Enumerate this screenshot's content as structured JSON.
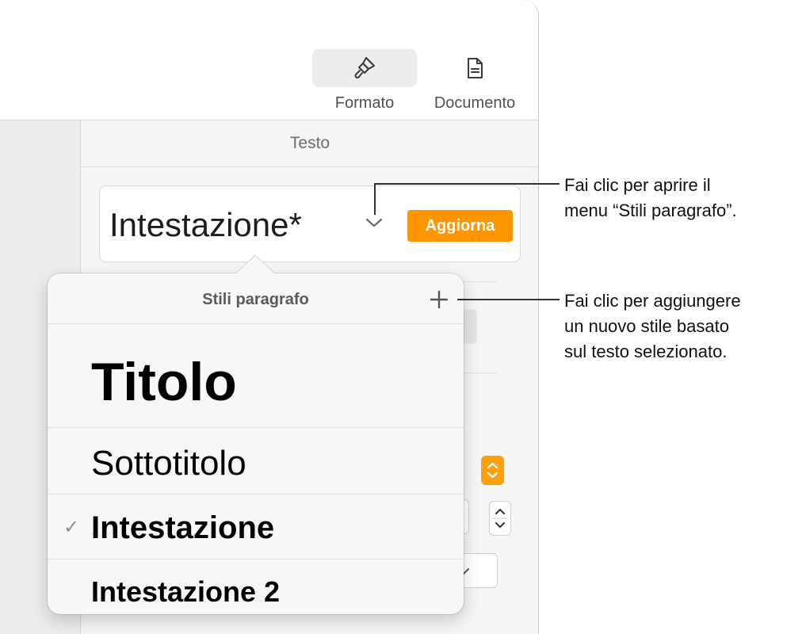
{
  "toolbar": {
    "format_label": "Formato",
    "document_label": "Documento",
    "icons": {
      "format": "paintbrush-icon",
      "document": "document-icon"
    }
  },
  "sidebar": {
    "section_title": "Testo",
    "paragraph_style": "Intestazione*",
    "update_label": "Aggiorna"
  },
  "popover": {
    "title": "Stili paragrafo",
    "styles": [
      {
        "label": "Titolo",
        "checked": false
      },
      {
        "label": "Sottotitolo",
        "checked": false
      },
      {
        "label": "Intestazione",
        "checked": true
      },
      {
        "label": "Intestazione 2",
        "checked": false
      }
    ],
    "check_glyph": "✓"
  },
  "callouts": {
    "menu": [
      "Fai clic per aprire il",
      "menu “Stili paragrafo”."
    ],
    "add": [
      "Fai clic per aggiungere",
      "un nuovo stile basato",
      "sul testo selezionato."
    ]
  },
  "colors": {
    "accent": "#ff9500"
  }
}
